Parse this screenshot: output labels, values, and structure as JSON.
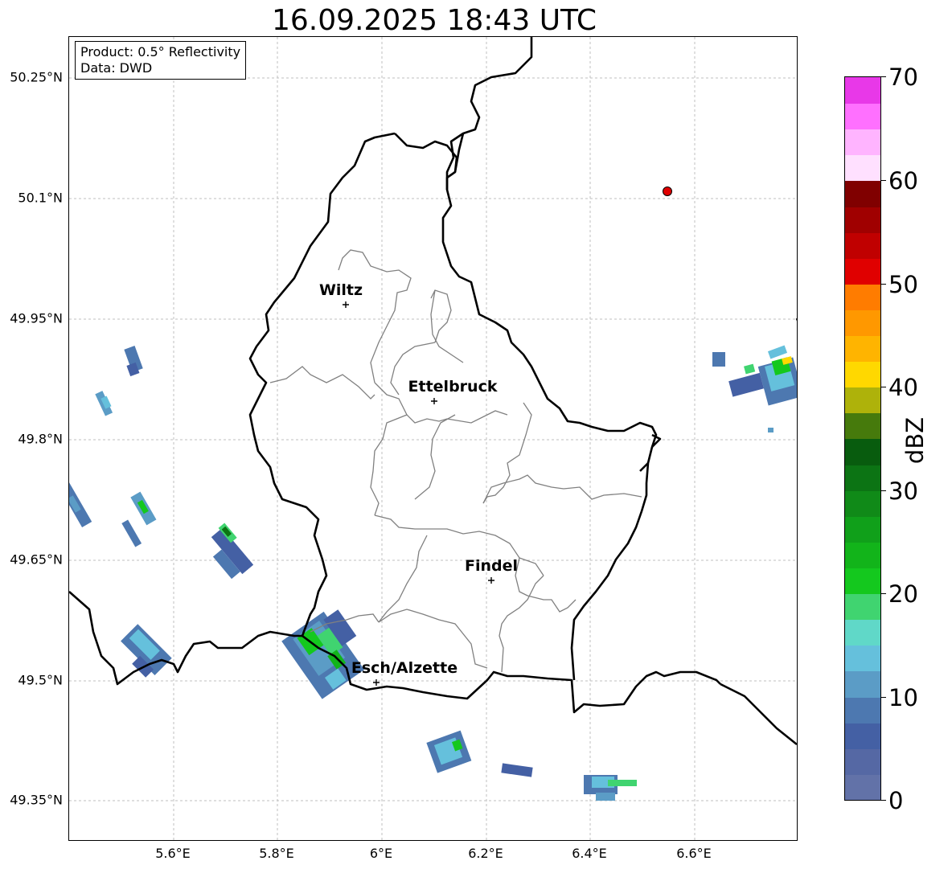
{
  "title": "16.09.2025 18:43 UTC",
  "info": {
    "product": "Product: 0.5° Reflectivity",
    "data": "Data: DWD"
  },
  "lat_ticks": [
    "50.25°N",
    "50.1°N",
    "49.95°N",
    "49.8°N",
    "49.65°N",
    "49.5°N",
    "49.35°N"
  ],
  "lon_ticks": [
    "5.6°E",
    "5.8°E",
    "6°E",
    "6.2°E",
    "6.4°E",
    "6.6°E"
  ],
  "cities": [
    {
      "name": "Wiltz"
    },
    {
      "name": "Ettelbruck"
    },
    {
      "name": "Findel"
    },
    {
      "name": "Esch/Alzette"
    }
  ],
  "colorbar": {
    "label": "dBZ",
    "ticks": [
      "70",
      "60",
      "50",
      "40",
      "30",
      "20",
      "10",
      "0"
    ],
    "colors": [
      "#6272a8",
      "#5568a4",
      "#4460a4",
      "#4d78b0",
      "#5b9cc6",
      "#65c0dc",
      "#60d8c8",
      "#40d470",
      "#14c81e",
      "#12b41a",
      "#10a01a",
      "#108a18",
      "#0c7414",
      "#085c0e",
      "#467a0c",
      "#aeb20a",
      "#ffd800",
      "#ffb400",
      "#ff9800",
      "#ff7c00",
      "#e00000",
      "#c00000",
      "#a00000",
      "#800000",
      "#ffe0ff",
      "#ffb4ff",
      "#ff70ff",
      "#e838e8"
    ]
  },
  "colors": {
    "border": "#000000",
    "cantons": "#808080",
    "grid": "#bfbfbf",
    "radar_marker": "#e00000"
  }
}
